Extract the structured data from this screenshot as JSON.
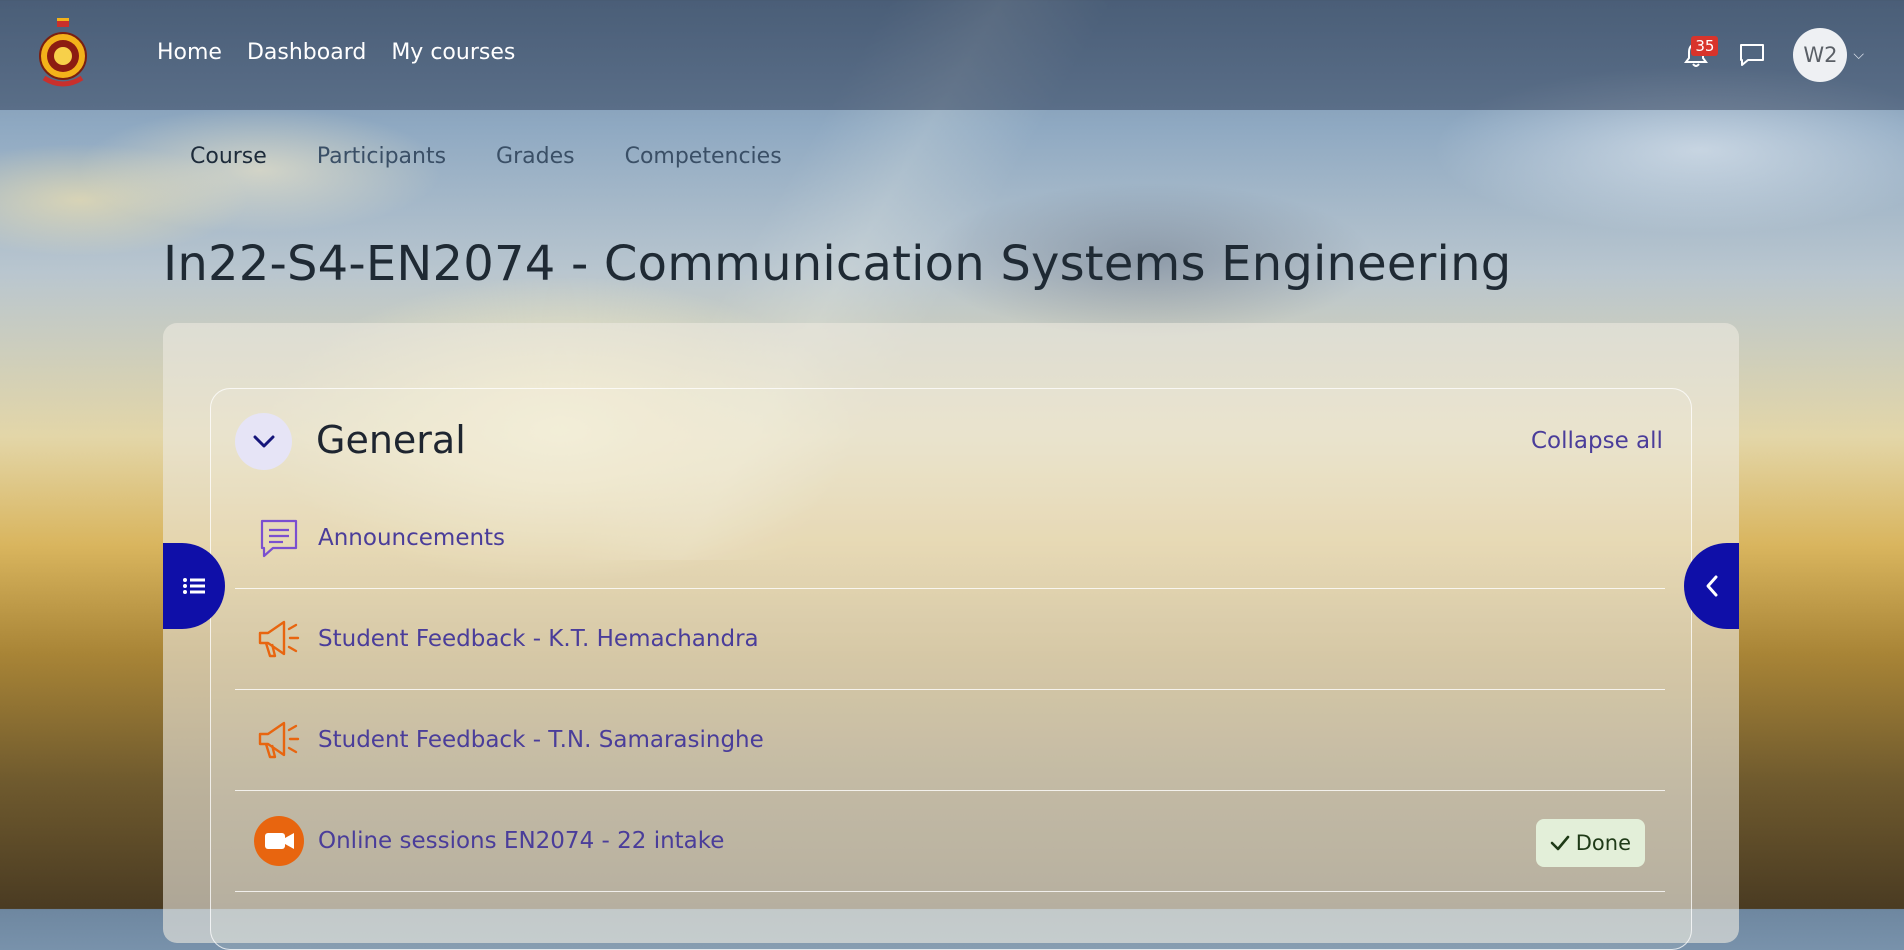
{
  "nav": {
    "items": [
      {
        "label": "Home"
      },
      {
        "label": "Dashboard"
      },
      {
        "label": "My courses"
      }
    ],
    "notifications_count": "35",
    "avatar_initials": "W2"
  },
  "course_tabs": [
    {
      "label": "Course",
      "active": true
    },
    {
      "label": "Participants",
      "active": false
    },
    {
      "label": "Grades",
      "active": false
    },
    {
      "label": "Competencies",
      "active": false
    }
  ],
  "page_title": "In22-S4-EN2074 - Communication Systems Engineering",
  "section": {
    "title": "General",
    "collapse_label": "Collapse all",
    "activities": [
      {
        "label": "Announcements",
        "icon": "forum-icon"
      },
      {
        "label": "Student Feedback - K.T. Hemachandra",
        "icon": "megaphone-icon"
      },
      {
        "label": "Student Feedback - T.N. Samarasinghe",
        "icon": "megaphone-icon"
      },
      {
        "label": "Online sessions EN2074 - 22 intake",
        "icon": "video-icon",
        "completion": "Done"
      }
    ]
  },
  "colors": {
    "accent": "#0f0fa8",
    "link": "#4a3d9a",
    "feedback_icon": "#e8650f",
    "done_bg": "#e3efd9"
  }
}
